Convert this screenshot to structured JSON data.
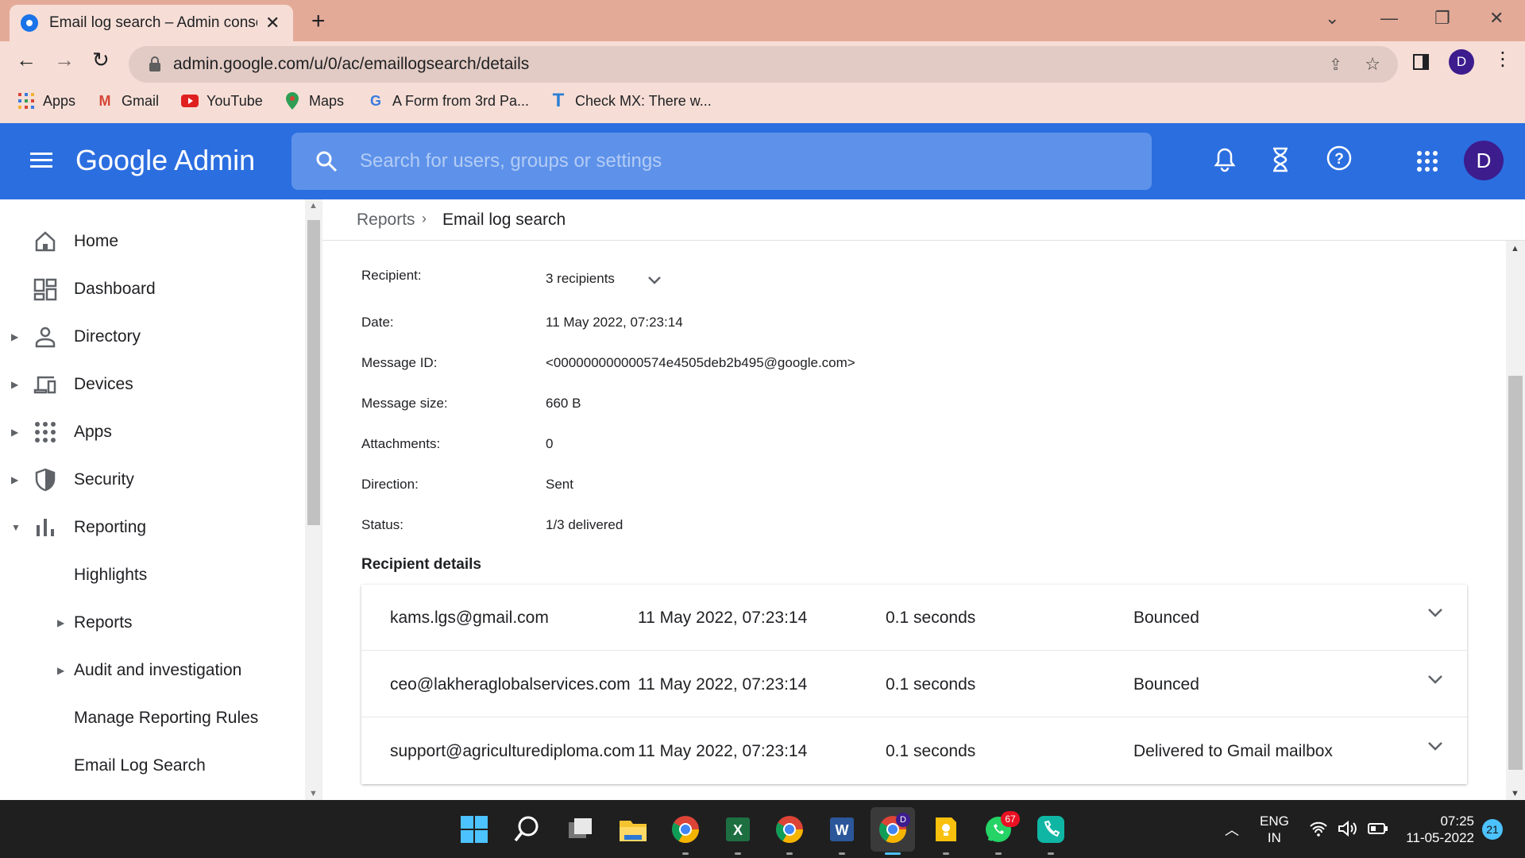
{
  "browser": {
    "tab_title": "Email log search – Admin console",
    "url": "admin.google.com/u/0/ac/emaillogsearch/details",
    "profile_initial": "D",
    "bookmarks": [
      "Apps",
      "Gmail",
      "YouTube",
      "Maps",
      "A Form from 3rd Pa...",
      "Check MX: There w..."
    ]
  },
  "appbar": {
    "brand": "Google Admin",
    "search_placeholder": "Search for users, groups or settings",
    "avatar_initial": "D",
    "icons": [
      "menu-icon",
      "search-icon",
      "bell-icon",
      "hourglass-icon",
      "help-icon",
      "apps-grid-icon"
    ]
  },
  "sidebar": {
    "items": [
      {
        "label": "Home",
        "icon": "home-icon",
        "expander": ""
      },
      {
        "label": "Dashboard",
        "icon": "dashboard-icon",
        "expander": ""
      },
      {
        "label": "Directory",
        "icon": "person-icon",
        "expander": "right"
      },
      {
        "label": "Devices",
        "icon": "devices-icon",
        "expander": "right"
      },
      {
        "label": "Apps",
        "icon": "apps-icon",
        "expander": "right"
      },
      {
        "label": "Security",
        "icon": "shield-icon",
        "expander": "right"
      },
      {
        "label": "Reporting",
        "icon": "bar-chart-icon",
        "expander": "down"
      },
      {
        "label": "Highlights",
        "icon": "",
        "expander": ""
      },
      {
        "label": "Reports",
        "icon": "",
        "expander": "right"
      },
      {
        "label": "Audit and investigation",
        "icon": "",
        "expander": "right"
      },
      {
        "label": "Manage Reporting Rules",
        "icon": "",
        "expander": ""
      },
      {
        "label": "Email Log Search",
        "icon": "",
        "expander": ""
      }
    ]
  },
  "breadcrumb": {
    "parent": "Reports",
    "current": "Email log search"
  },
  "details": {
    "recipient_label": "Recipient:",
    "recipient_value": "3 recipients",
    "date_label": "Date:",
    "date_value": "11 May 2022, 07:23:14",
    "message_id_label": "Message ID:",
    "message_id_value": "<000000000000574e4505deb2b495@google.com>",
    "size_label": "Message size:",
    "size_value": "660 B",
    "attachments_label": "Attachments:",
    "attachments_value": "0",
    "direction_label": "Direction:",
    "direction_value": "Sent",
    "status_label": "Status:",
    "status_value": "1/3 delivered"
  },
  "recipient_details": {
    "heading": "Recipient details",
    "rows": [
      {
        "email": "kams.lgs@gmail.com",
        "date": "11 May 2022, 07:23:14",
        "duration": "0.1 seconds",
        "status": "Bounced"
      },
      {
        "email": "ceo@lakheraglobalservices.com",
        "date": "11 May 2022, 07:23:14",
        "duration": "0.1 seconds",
        "status": "Bounced"
      },
      {
        "email": "support@agriculturediploma.com",
        "date": "11 May 2022, 07:23:14",
        "duration": "0.1 seconds",
        "status": "Delivered to Gmail mailbox"
      }
    ]
  },
  "taskbar": {
    "lang_top": "ENG",
    "lang_bottom": "IN",
    "time": "07:25",
    "date": "11-05-2022",
    "notification_count": "21",
    "whatsapp_badge": "67",
    "chrome_profile_badge": "D"
  },
  "colors": {
    "appbar": "#2b6ee0",
    "tabbar": "#e4aa98",
    "toolbar": "#f6ded6",
    "avatar": "#3d1c8e"
  }
}
